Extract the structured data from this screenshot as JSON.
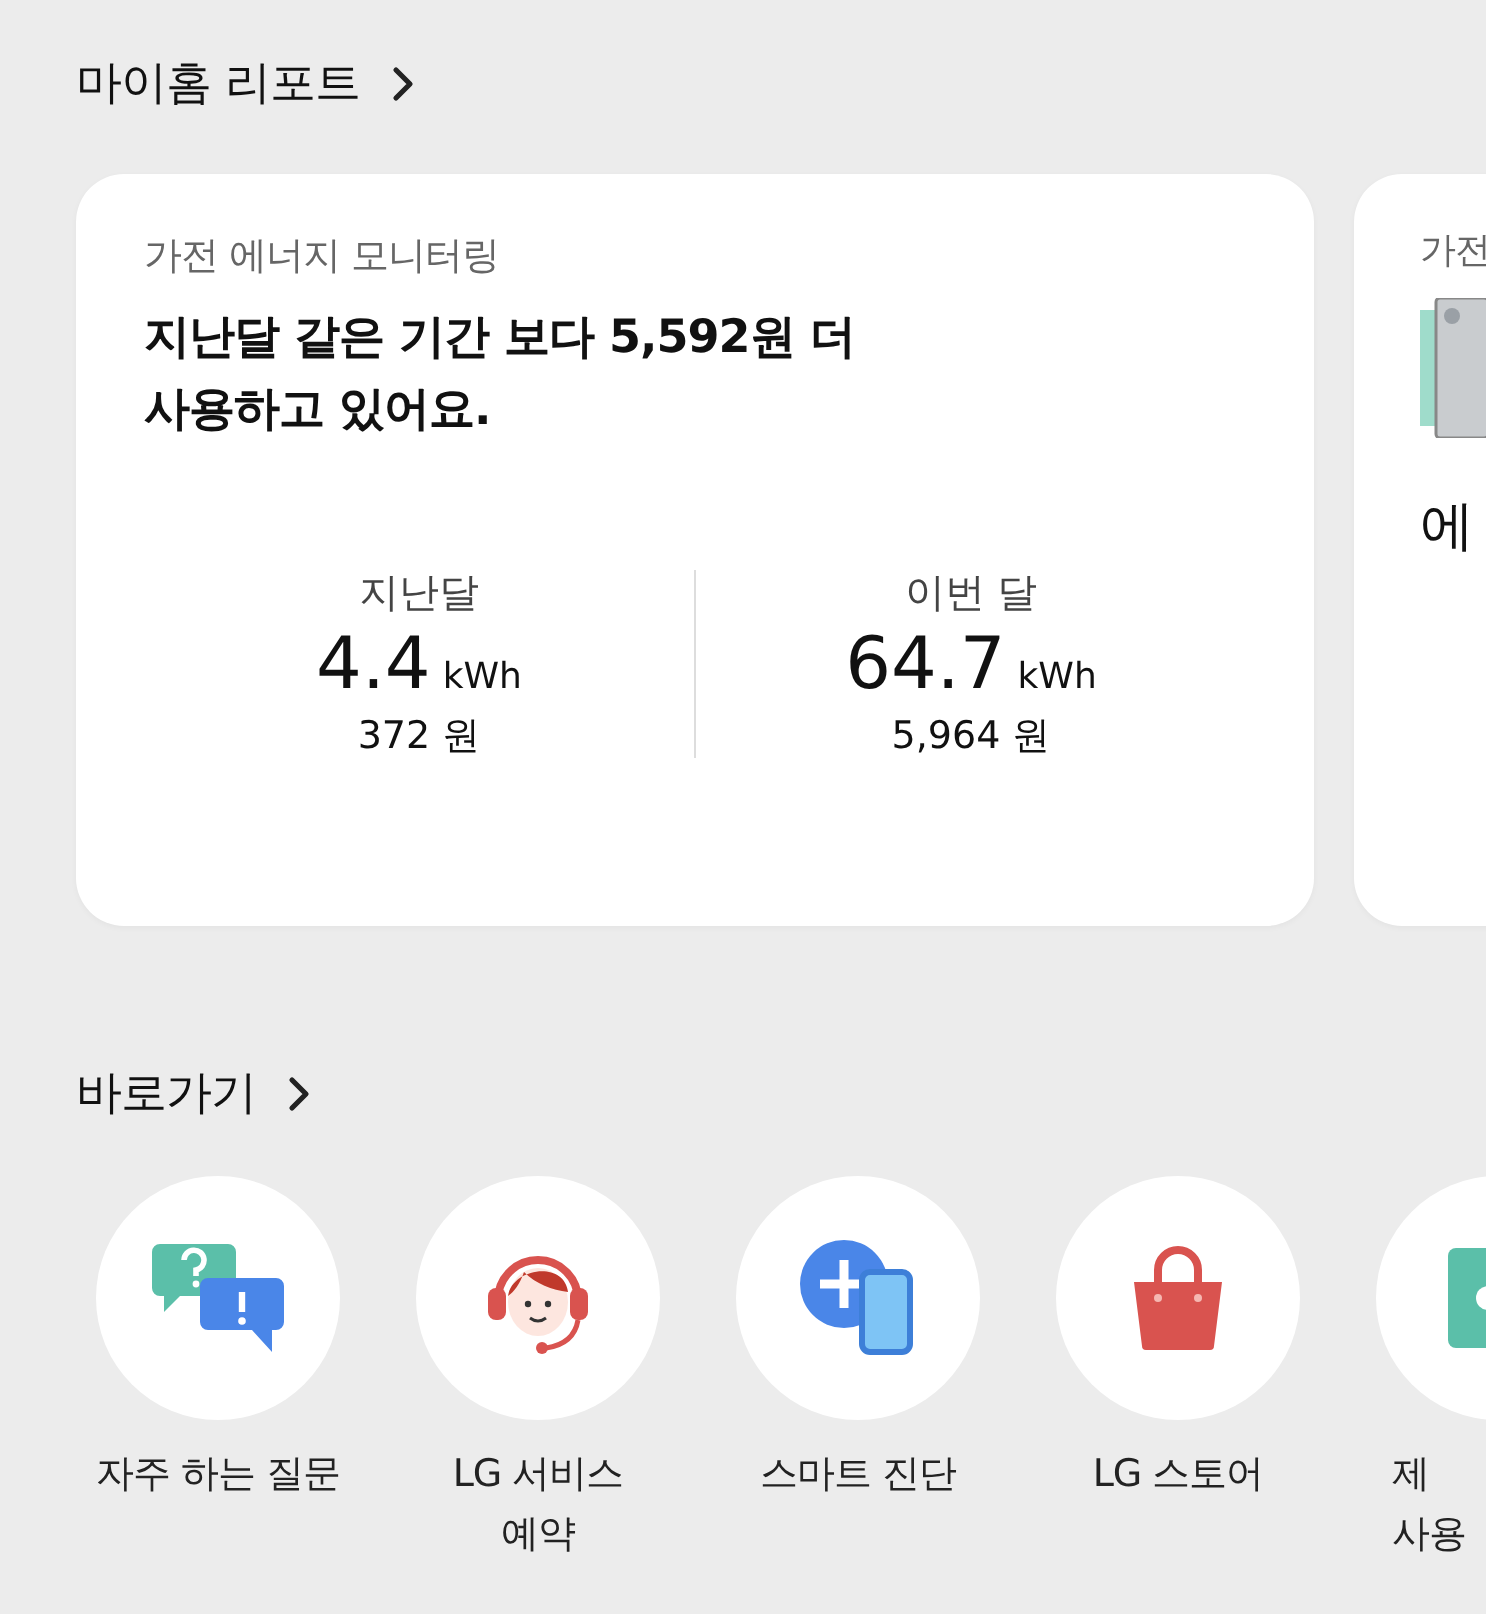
{
  "report_section": {
    "title": "마이홈 리포트"
  },
  "energy_card": {
    "title": "가전 에너지 모니터링",
    "headline": "지난달 같은 기간 보다 5,592원 더\n사용하고 있어요.",
    "stats": [
      {
        "label": "지난달",
        "value": "4.4",
        "unit": "kWh",
        "cost": "372 원"
      },
      {
        "label": "이번 달",
        "value": "64.7",
        "unit": "kWh",
        "cost": "5,964 원"
      }
    ]
  },
  "next_card": {
    "title": "가전",
    "headline": "에"
  },
  "shortcuts_section": {
    "title": "바로가기"
  },
  "shortcuts": [
    {
      "kind": "faq",
      "label": "자주 하는 질문"
    },
    {
      "kind": "service",
      "label": "LG 서비스\n예약"
    },
    {
      "kind": "diagnosis",
      "label": "스마트 진단"
    },
    {
      "kind": "store",
      "label": "LG 스토어"
    },
    {
      "kind": "manual",
      "label": "제\n사용"
    }
  ]
}
